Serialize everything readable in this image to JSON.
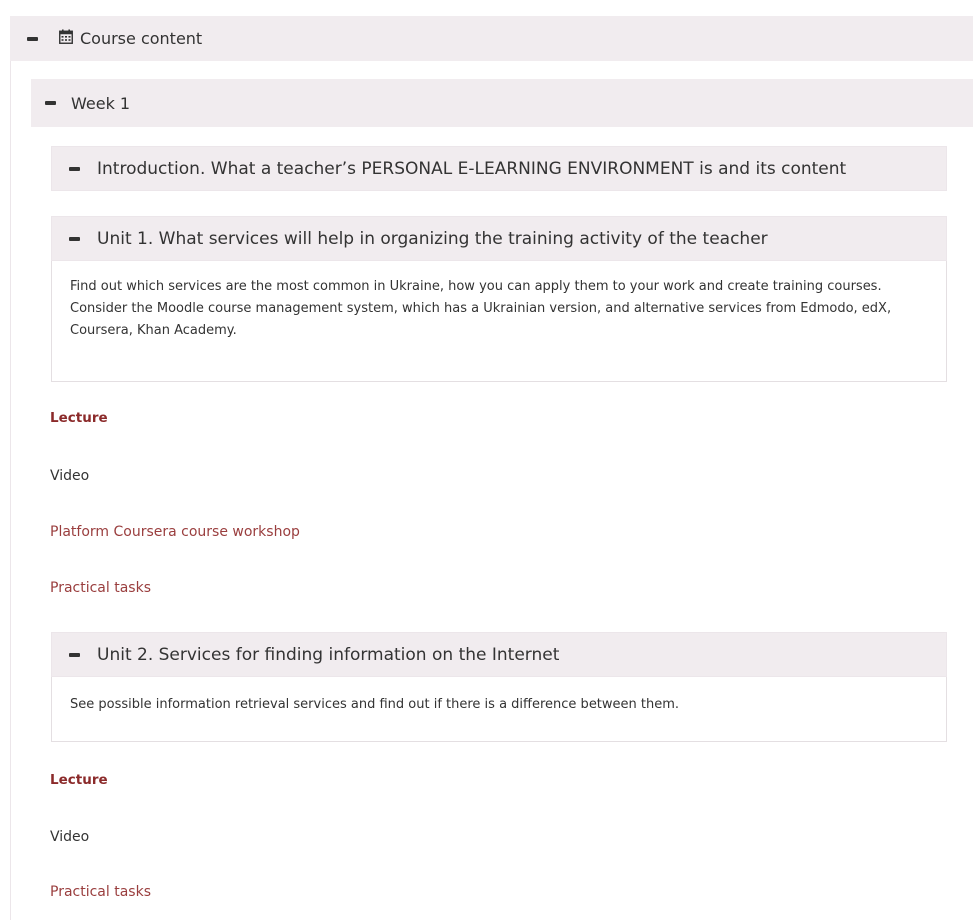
{
  "course_content": {
    "title": "Course content"
  },
  "week": {
    "title": "Week 1"
  },
  "units": [
    {
      "title": "Introduction. What a teacher’s PERSONAL E-LEARNING ENVIRONMENT is and its content"
    },
    {
      "title": "Unit 1. What services will help in organizing the training activity of the teacher",
      "description": "Find out which services are the most common in Ukraine, how you can apply them to your work and create training courses. Consider the Moodle course management system, which has a Ukrainian version, and alternative services from Edmodo, edX, Coursera, Khan Academy.",
      "items": [
        {
          "label": "Lecture"
        },
        {
          "label": "Video"
        },
        {
          "label": "Platform Coursera course workshop"
        },
        {
          "label": "Practical tasks"
        }
      ]
    },
    {
      "title": "Unit 2. Services for finding information on the Internet",
      "description": "See possible information retrieval services and find out if there is a difference between them.",
      "items": [
        {
          "label": "Lecture"
        },
        {
          "label": "Video"
        },
        {
          "label": "Practical tasks"
        }
      ]
    }
  ],
  "colors": {
    "header_bg": "#f1ecef",
    "link": "#9a3e3e",
    "lecture": "#8b2a2a",
    "text": "#333333"
  },
  "icons": {
    "collapse": "minus-icon",
    "calendar": "calendar-icon"
  }
}
